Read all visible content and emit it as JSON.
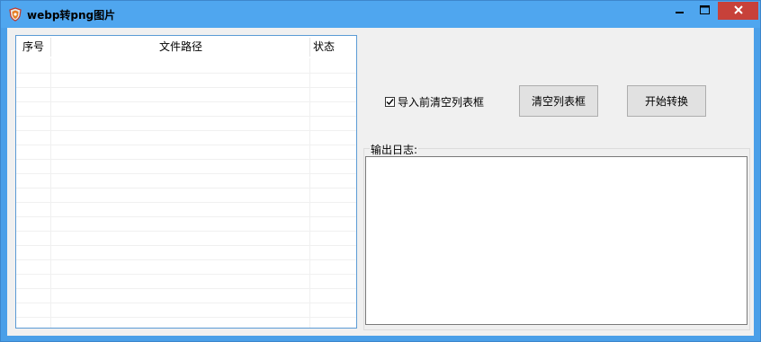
{
  "window": {
    "title": "webp转png图片",
    "icon": "shield-app-icon",
    "controls": {
      "minimize": "minimize-icon",
      "maximize": "maximize-icon",
      "close": "close-icon"
    }
  },
  "file_list": {
    "columns": [
      "序号",
      "文件路径",
      "状态"
    ],
    "rows": []
  },
  "options": {
    "clear_before_import_label": "导入前清空列表框",
    "clear_before_import_checked": true
  },
  "buttons": {
    "clear_list": "清空列表框",
    "start_convert": "开始转换"
  },
  "log": {
    "group_label": "输出日志:",
    "content": ""
  },
  "colors": {
    "titlebar": "#4fa6ef",
    "close_button": "#c7413a",
    "list_border": "#5b9bd5",
    "client_bg": "#f0f0f0"
  }
}
